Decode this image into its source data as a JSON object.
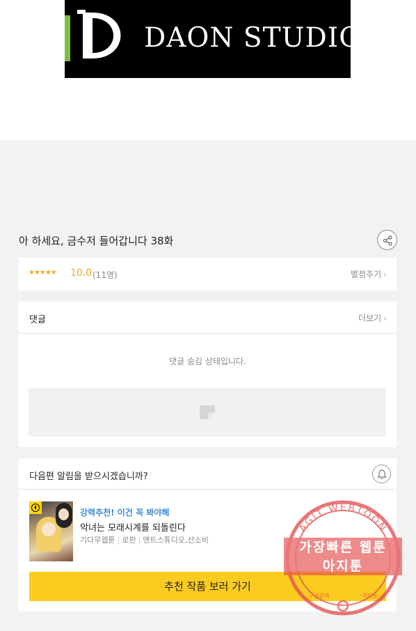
{
  "banner": {
    "brand": "DAON STUDIO"
  },
  "episode": {
    "title": "아 하세요, 금수저 들어갑니다 38화"
  },
  "rating": {
    "stars": "★★★★★",
    "score": "10.0",
    "count": "(11명)",
    "rate_label": "별점주기"
  },
  "comments": {
    "title": "댓글",
    "more_label": "더보기",
    "hidden_message": "댓글 숨김 상태입니다."
  },
  "notify": {
    "question": "다음편 알림을 받으시겠습니까?",
    "recommend": {
      "tag": "강력추천! 이건 꼭 봐야해",
      "title": "악녀는 모래시계를 되돌린다",
      "meta": [
        "기다무웹툰",
        "로판",
        "앤트스튜디오,산소비"
      ],
      "button_label": "추천 작품 보러 가기"
    }
  },
  "watermark": {
    "arc_text": "AGIT WEBTOON",
    "line1": "가장빠른 웹툰",
    "line2": "아지툰",
    "bottom_left": "구글검색",
    "bottom_right": "아지툰"
  },
  "colors": {
    "accent_star": "#f5a623",
    "button_yellow": "#fccb1f",
    "tag_blue": "#3c8ad8",
    "logo_green": "#7ac043",
    "watermark_red": "#e45050"
  },
  "icons": {
    "share": "share-icon",
    "bell": "bell-icon",
    "chevron": "chevron-right-icon",
    "ad_placeholder": "image-placeholder-icon",
    "clock": "clock-icon"
  }
}
